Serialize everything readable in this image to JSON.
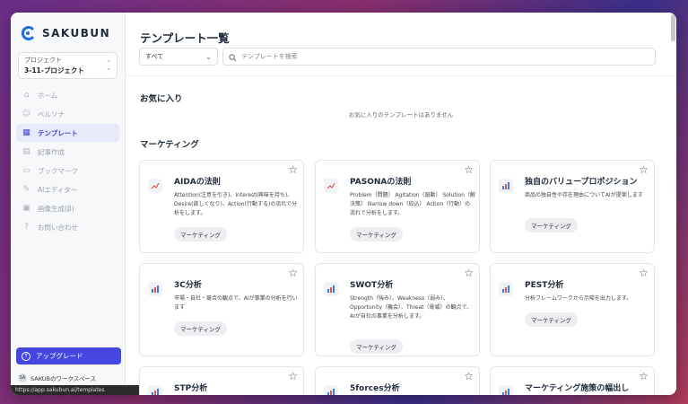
{
  "brand": {
    "name": "SAKUBUN"
  },
  "project": {
    "label": "プロジェクト",
    "name": "3-11-プロジェクト"
  },
  "nav": [
    {
      "label": "ホーム",
      "icon": "home-icon",
      "glyph": "⌂",
      "active": false
    },
    {
      "label": "ペルソナ",
      "icon": "persona-icon",
      "glyph": "☺",
      "active": false
    },
    {
      "label": "テンプレート",
      "icon": "grid-icon",
      "glyph": "▦",
      "active": true
    },
    {
      "label": "記事作成",
      "icon": "document-icon",
      "glyph": "▤",
      "active": false
    },
    {
      "label": "ブックマーク",
      "icon": "bookmark-icon",
      "glyph": "▭",
      "active": false
    },
    {
      "label": "AIエディター",
      "icon": "edit-icon",
      "glyph": "✎",
      "active": false
    },
    {
      "label": "画像生成(β)",
      "icon": "image-icon",
      "glyph": "▣",
      "active": false
    },
    {
      "label": "お問い合わせ",
      "icon": "help-icon",
      "glyph": "?",
      "active": false
    }
  ],
  "upgrade_label": "アップグレード",
  "workspace": {
    "avatar": "SA",
    "name": "SAKUBのワークスペース"
  },
  "status_url": "https://app.sakubun.ai/templates",
  "header": {
    "title": "テンプレート一覧"
  },
  "filter": {
    "selected": "すべて"
  },
  "search": {
    "placeholder": "テンプレートを検索"
  },
  "favorites": {
    "title": "お気に入り",
    "empty": "お気に入りのテンプレートはありません"
  },
  "marketing": {
    "title": "マーケティング",
    "cards": [
      {
        "title": "AIDAの法則",
        "desc": "Attention(注意を引き)、Interest(興味を持ち)、Desire(欲しくなり)、Action(行動する)の流れで分析をします。",
        "tag": "マーケティング",
        "icon": "trend-icon"
      },
      {
        "title": "PASONAの法則",
        "desc": "Problem（問題） Agitation（扇動） Solution（解決策） Narrow down（絞込） Action（行動）の流れで分析をします。",
        "tag": "マーケティング",
        "icon": "trend-icon"
      },
      {
        "title": "独自のバリュープロポジション",
        "desc": "商品の独自性や存在理由についてAIが提案します",
        "tag": "マーケティング",
        "icon": "bar-chart-icon"
      },
      {
        "title": "3C分析",
        "desc": "市場・自社・競合の観点で、AIが事業の分析を行います",
        "tag": "マーケティング",
        "icon": "bar-chart-icon"
      },
      {
        "title": "SWOT分析",
        "desc": "Strength（強み）、Weakness（弱み）、Opportunity（機会）、Threat（脅威）の観点で、AIが自社の事業を分析します。",
        "tag": "マーケティング",
        "icon": "bar-chart-icon"
      },
      {
        "title": "PEST分析",
        "desc": "分析フレームワークから示唆を出力します。",
        "tag": "マーケティング",
        "icon": "bar-chart-icon"
      },
      {
        "title": "STP分析",
        "desc": "",
        "tag": "",
        "icon": "bar-chart-icon"
      },
      {
        "title": "5forces分析",
        "desc": "",
        "tag": "",
        "icon": "bar-chart-icon"
      },
      {
        "title": "マーケティング施策の幅出し",
        "desc": "",
        "tag": "",
        "icon": "bar-chart-icon"
      }
    ]
  }
}
